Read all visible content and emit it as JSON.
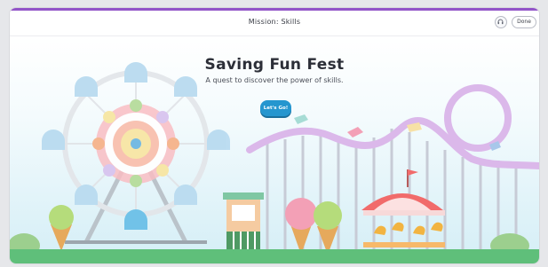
{
  "header": {
    "title": "Mission: Skills",
    "done_label": "Done",
    "audio_icon": "headphones-icon"
  },
  "hero": {
    "title": "Saving Fun Fest",
    "subtitle": "A quest to discover the power of skills.",
    "cta_label": "Let's Go!"
  },
  "colors": {
    "accent": "#9254c8",
    "cta": "#2596cf",
    "ground": "#5fbf7a",
    "sky": "#d4eef6"
  }
}
